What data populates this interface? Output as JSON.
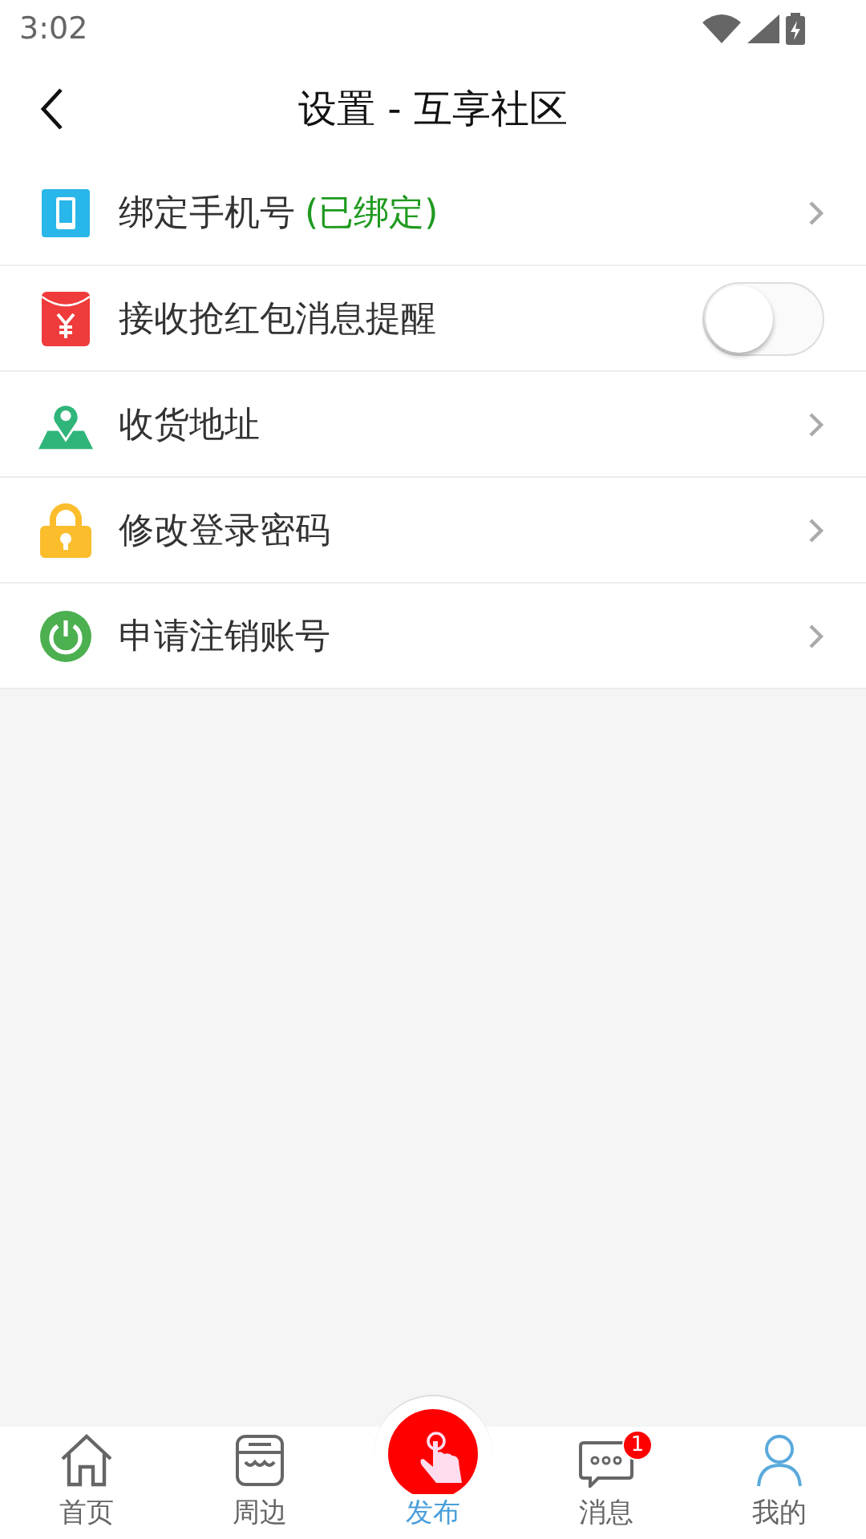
{
  "status_bar": {
    "time": "3:02"
  },
  "header": {
    "title": "设置 - 互享社区"
  },
  "settings": [
    {
      "kind": "link",
      "label": "绑定手机号",
      "status": "(已绑定)"
    },
    {
      "kind": "toggle",
      "label": "接收抢红包消息提醒",
      "on": false
    },
    {
      "kind": "link",
      "label": "收货地址"
    },
    {
      "kind": "link",
      "label": "修改登录密码"
    },
    {
      "kind": "link",
      "label": "申请注销账号"
    }
  ],
  "tab_bar": [
    {
      "label": "首页",
      "selected": false
    },
    {
      "label": "周边",
      "selected": false
    },
    {
      "label": "发布",
      "selected": true,
      "kind": "raised"
    },
    {
      "label": "消息",
      "selected": false,
      "badge": "1"
    },
    {
      "label": "我的",
      "selected": false
    }
  ]
}
